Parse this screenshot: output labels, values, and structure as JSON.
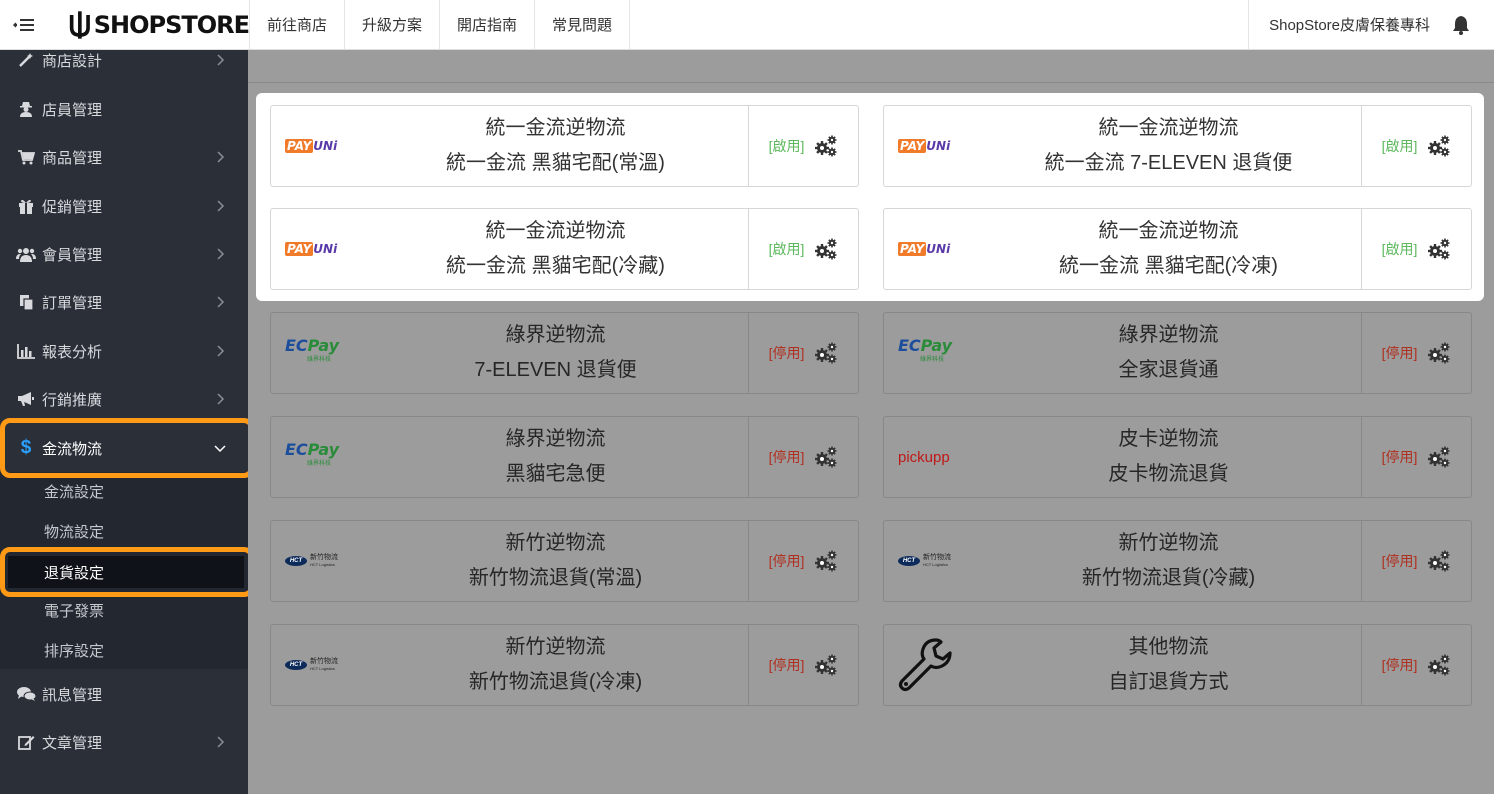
{
  "topbar": {
    "brand": "SHOPSTORE",
    "nav": [
      "前往商店",
      "升級方案",
      "開店指南",
      "常見問題"
    ],
    "store_name": "ShopStore皮膚保養專科"
  },
  "sidebar": {
    "items": [
      {
        "label": "商店設計",
        "icon": "magic-wand-icon"
      },
      {
        "label": "店員管理",
        "icon": "user-secret-icon"
      },
      {
        "label": "商品管理",
        "icon": "cart-icon"
      },
      {
        "label": "促銷管理",
        "icon": "gift-icon"
      },
      {
        "label": "會員管理",
        "icon": "users-icon"
      },
      {
        "label": "訂單管理",
        "icon": "copy-icon"
      },
      {
        "label": "報表分析",
        "icon": "bar-chart-icon"
      },
      {
        "label": "行銷推廣",
        "icon": "bullhorn-icon"
      },
      {
        "label": "金流物流",
        "icon": "dollar-icon"
      },
      {
        "label": "訊息管理",
        "icon": "comments-icon"
      },
      {
        "label": "文章管理",
        "icon": "edit-icon"
      }
    ],
    "submenu": [
      "金流設定",
      "物流設定",
      "退貨設定",
      "電子發票",
      "排序設定"
    ]
  },
  "cards": [
    {
      "line1": "統一金流逆物流",
      "line2": "統一金流 黑貓宅配(常溫)",
      "status": "[啟用]",
      "logo": "PAYUNi"
    },
    {
      "line1": "統一金流逆物流",
      "line2": "統一金流 7-ELEVEN 退貨便",
      "status": "[啟用]",
      "logo": "PAYUNi"
    },
    {
      "line1": "統一金流逆物流",
      "line2": "統一金流 黑貓宅配(冷藏)",
      "status": "[啟用]",
      "logo": "PAYUNi"
    },
    {
      "line1": "統一金流逆物流",
      "line2": "統一金流 黑貓宅配(冷凍)",
      "status": "[啟用]",
      "logo": "PAYUNi"
    },
    {
      "line1": "綠界逆物流",
      "line2": "7-ELEVEN 退貨便",
      "status": "[停用]",
      "logo": "ECPay"
    },
    {
      "line1": "綠界逆物流",
      "line2": "全家退貨通",
      "status": "[停用]",
      "logo": "ECPay"
    },
    {
      "line1": "綠界逆物流",
      "line2": "黑貓宅急便",
      "status": "[停用]",
      "logo": "ECPay"
    },
    {
      "line1": "皮卡逆物流",
      "line2": "皮卡物流退貨",
      "status": "[停用]",
      "logo": "pickupp"
    },
    {
      "line1": "新竹逆物流",
      "line2": "新竹物流退貨(常溫)",
      "status": "[停用]",
      "logo": "HCT"
    },
    {
      "line1": "新竹逆物流",
      "line2": "新竹物流退貨(冷藏)",
      "status": "[停用]",
      "logo": "HCT"
    },
    {
      "line1": "新竹逆物流",
      "line2": "新竹物流退貨(冷凍)",
      "status": "[停用]",
      "logo": "HCT"
    },
    {
      "line1": "其他物流",
      "line2": "自訂退貨方式",
      "status": "[停用]",
      "logo": "wrench"
    }
  ],
  "logos": {
    "payuni_a": "PAY",
    "payuni_b": "UNi",
    "ecpay_a": "EC",
    "ecpay_b": "Pay",
    "ecpay_sub": "綠界科技",
    "pickupp": "pickupp",
    "hct_mark": "HCT",
    "hct_name": "新竹物流",
    "hct_sub": "HCT Logistics"
  },
  "colors": {
    "accent": "#ff9a17",
    "sidebar_bg": "#2a2f38",
    "enabled": "#5cb85c",
    "disabled": "#b03020"
  }
}
